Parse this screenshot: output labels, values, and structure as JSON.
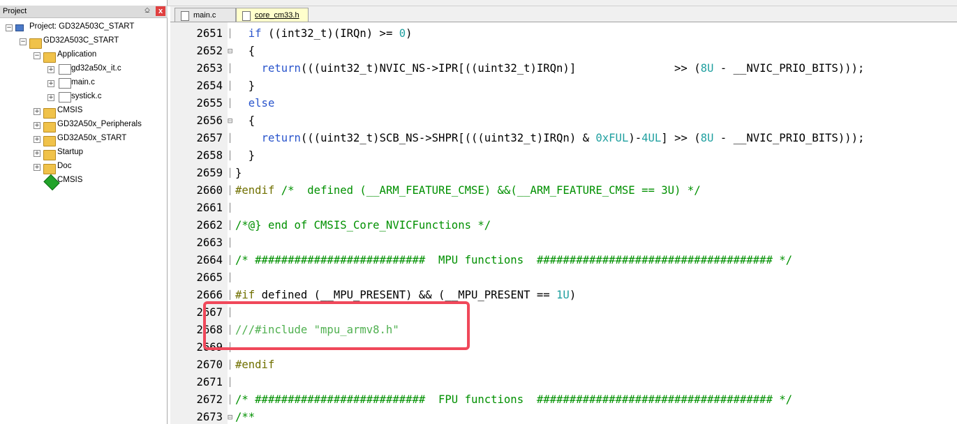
{
  "project_panel": {
    "title": "Project",
    "pin": "⎐",
    "close": "x",
    "tree": [
      {
        "label": "Project: GD32A503C_START",
        "level": 0,
        "icon": "project-icon",
        "expander": "−"
      },
      {
        "label": "GD32A503C_START",
        "level": 1,
        "icon": "target-icon",
        "expander": "−"
      },
      {
        "label": "Application",
        "level": 2,
        "icon": "folder-icon",
        "expander": "−"
      },
      {
        "label": "gd32a50x_it.c",
        "level": 3,
        "icon": "file-icon",
        "expander": "+"
      },
      {
        "label": "main.c",
        "level": 3,
        "icon": "file-icon",
        "expander": "+"
      },
      {
        "label": "systick.c",
        "level": 3,
        "icon": "file-icon",
        "expander": "+"
      },
      {
        "label": "CMSIS",
        "level": 2,
        "icon": "folder-icon",
        "expander": "+"
      },
      {
        "label": "GD32A50x_Peripherals",
        "level": 2,
        "icon": "folder-icon",
        "expander": "+"
      },
      {
        "label": "GD32A50x_START",
        "level": 2,
        "icon": "folder-icon",
        "expander": "+"
      },
      {
        "label": "Startup",
        "level": 2,
        "icon": "folder-icon",
        "expander": "+"
      },
      {
        "label": "Doc",
        "level": 2,
        "icon": "folder-icon",
        "expander": "+"
      },
      {
        "label": "CMSIS",
        "level": 2,
        "icon": "diamond-icon",
        "expander": ""
      }
    ]
  },
  "tabs": [
    {
      "label": "main.c",
      "active": false
    },
    {
      "label": "core_cm33.h",
      "active": true
    }
  ],
  "editor": {
    "lines": [
      {
        "num": "2651",
        "fold": "",
        "html": "  <span class='kw'>if</span> <span class='txt'>((int32_t)(IRQn) &gt;= </span><span class='num'>0</span><span class='txt'>)</span>"
      },
      {
        "num": "2652",
        "fold": "⊟",
        "html": "  <span class='txt'>{</span>"
      },
      {
        "num": "2653",
        "fold": "",
        "html": "    <span class='kw'>return</span><span class='txt'>(((uint32_t)NVIC_NS-&gt;IPR[((uint32_t)IRQn)]               &gt;&gt; (</span><span class='num'>8U</span><span class='txt'> - __NVIC_PRIO_BITS)));</span>"
      },
      {
        "num": "2654",
        "fold": "",
        "html": "  <span class='txt'>}</span>"
      },
      {
        "num": "2655",
        "fold": "",
        "html": "  <span class='kw'>else</span>"
      },
      {
        "num": "2656",
        "fold": "⊟",
        "html": "  <span class='txt'>{</span>"
      },
      {
        "num": "2657",
        "fold": "",
        "html": "    <span class='kw'>return</span><span class='txt'>(((uint32_t)SCB_NS-&gt;SHPR[(((uint32_t)IRQn) &amp; </span><span class='num'>0xFUL</span><span class='txt'>)-</span><span class='num'>4UL</span><span class='txt'>] &gt;&gt; (</span><span class='num'>8U</span><span class='txt'> - __NVIC_PRIO_BITS)));</span>"
      },
      {
        "num": "2658",
        "fold": "",
        "html": "  <span class='txt'>}</span>"
      },
      {
        "num": "2659",
        "fold": "",
        "html": "<span class='txt'>}</span>"
      },
      {
        "num": "2660",
        "fold": "",
        "html": "<span class='pp'>#endif</span> <span class='cm'>/*  defined (__ARM_FEATURE_CMSE) &amp;&amp;(__ARM_FEATURE_CMSE == 3U) */</span>"
      },
      {
        "num": "2661",
        "fold": "",
        "html": ""
      },
      {
        "num": "2662",
        "fold": "",
        "html": "<span class='cm'>/*@} end of CMSIS_Core_NVICFunctions */</span>"
      },
      {
        "num": "2663",
        "fold": "",
        "html": ""
      },
      {
        "num": "2664",
        "fold": "",
        "html": "<span class='cm'>/* ##########################  MPU functions  #################################### */</span>"
      },
      {
        "num": "2665",
        "fold": "",
        "html": ""
      },
      {
        "num": "2666",
        "fold": "",
        "html": "<span class='pp'>#if</span> <span class='txt'>defined (__MPU_PRESENT) &amp;&amp; (__MPU_PRESENT == </span><span class='num'>1U</span><span class='txt'>)</span>"
      },
      {
        "num": "2667",
        "fold": "",
        "html": ""
      },
      {
        "num": "2668",
        "fold": "",
        "html": "<span class='cm' style='color:#50b050'>///#include \"mpu_armv8.h\"</span>"
      },
      {
        "num": "2669",
        "fold": "",
        "html": ""
      },
      {
        "num": "2670",
        "fold": "",
        "html": "<span class='pp'>#endif</span>"
      },
      {
        "num": "2671",
        "fold": "",
        "html": ""
      },
      {
        "num": "2672",
        "fold": "",
        "html": "<span class='cm'>/* ##########################  FPU functions  #################################### */</span>"
      },
      {
        "num": "2673",
        "fold": "⊟",
        "html": "<span class='cm'>/**</span>"
      }
    ]
  },
  "colors": {
    "keyword": "#2a55cc",
    "comment": "#009000",
    "preprocessor": "#707000",
    "number": "#20a0a0",
    "highlight_box": "#f0485a"
  }
}
